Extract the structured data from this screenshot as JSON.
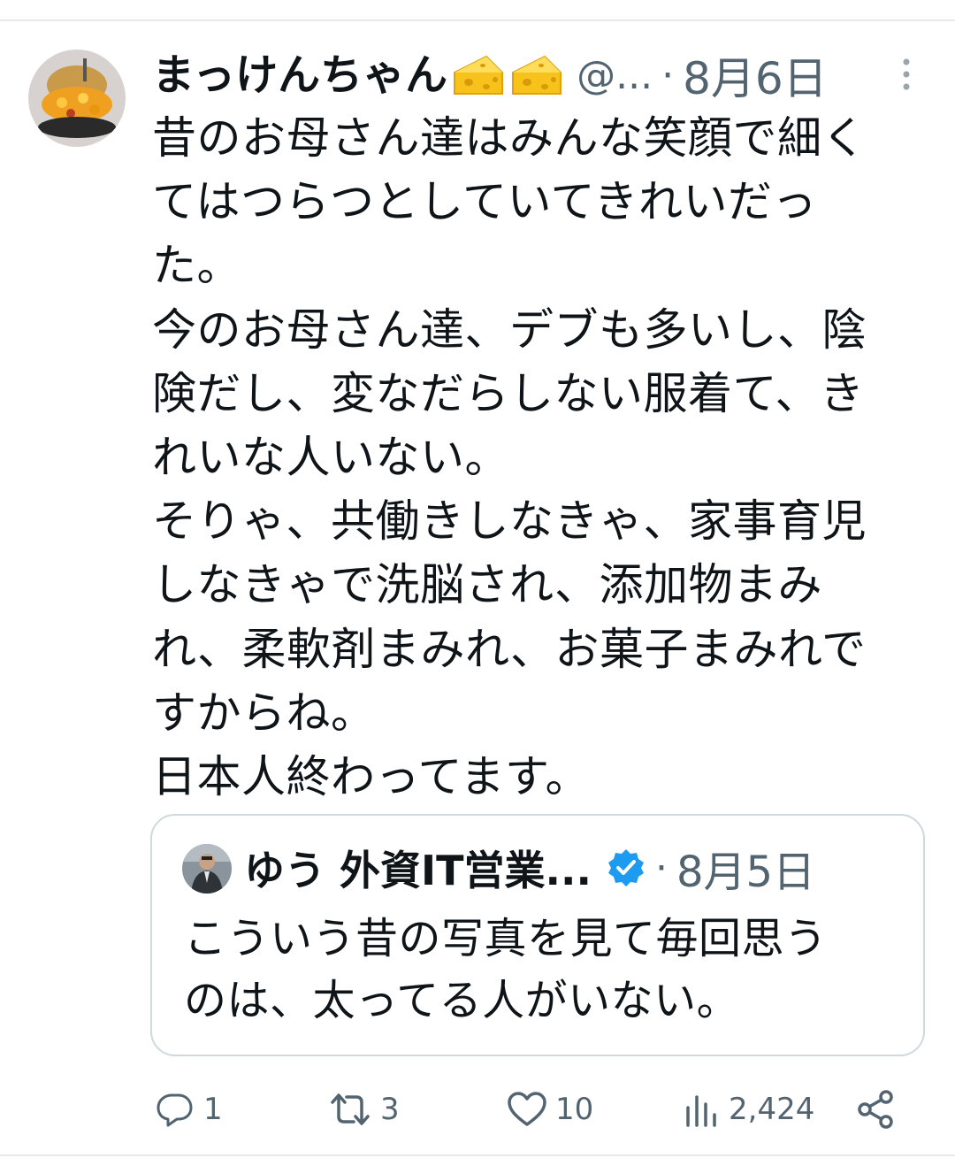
{
  "tweet": {
    "display_name": "まっけんちゃん",
    "name_emojis": [
      "cheese",
      "cheese"
    ],
    "handle": "@...",
    "separator": "·",
    "date": "8月6日",
    "body": "昔のお母さん達はみんな笑顔で細く\nてはつらつとしていてきれいだっ\nた。\n今のお母さん達、デブも多いし、陰\n険だし、変なだらしない服着て、き\nれいな人いない。\nそりゃ、共働きしなきゃ、家事育児\nしなきゃで洗脳され、添加物まみ\nれ、柔軟剤まみれ、お菓子まみれで\nすからね。\n日本人終わってます。"
  },
  "quote": {
    "display_name": "ゆう 外資IT営業...",
    "separator": "·",
    "date": "8月5日",
    "body": "こういう昔の写真を見て毎回思う\nのは、太ってる人がいない。",
    "verified": true,
    "verified_color": "#1d9bf0"
  },
  "actions": {
    "replies": "1",
    "retweets": "3",
    "likes": "10",
    "views": "2,424"
  },
  "colors": {
    "text": "#0f1419",
    "secondary": "#536471",
    "border": "#cfd9de",
    "divider": "#e7e9ea"
  }
}
